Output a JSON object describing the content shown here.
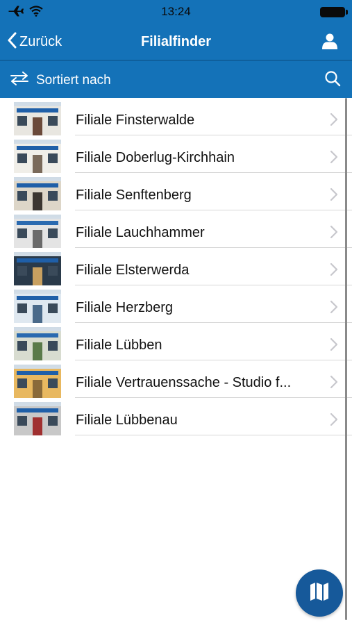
{
  "status_bar": {
    "time": "13:24"
  },
  "nav": {
    "back_label": "Zurück",
    "title": "Filialfinder"
  },
  "sort": {
    "label": "Sortiert nach"
  },
  "branches": [
    {
      "label": "Filiale Finsterwalde",
      "thumb": {
        "wall": "#e8e6e0",
        "sign": "#1f5fa8",
        "door": "#6b4a3a"
      }
    },
    {
      "label": "Filiale Doberlug-Kirchhain",
      "thumb": {
        "wall": "#f0eee8",
        "sign": "#1f5fa8",
        "door": "#7a6a5a"
      }
    },
    {
      "label": "Filiale Senftenberg",
      "thumb": {
        "wall": "#ddd6c8",
        "sign": "#1f5fa8",
        "door": "#3c3630"
      }
    },
    {
      "label": "Filiale Lauchhammer",
      "thumb": {
        "wall": "#e4e4e4",
        "sign": "#2a6ab0",
        "door": "#6a6a6a"
      }
    },
    {
      "label": "Filiale Elsterwerda",
      "thumb": {
        "wall": "#2a3a4a",
        "sign": "#1f5fa8",
        "door": "#c8a060"
      }
    },
    {
      "label": "Filiale Herzberg",
      "thumb": {
        "wall": "#dfe8f0",
        "sign": "#1f5fa8",
        "door": "#4a6a8a"
      }
    },
    {
      "label": "Filiale Lübben",
      "thumb": {
        "wall": "#d8dcd0",
        "sign": "#2a6ab0",
        "door": "#5a7a4a"
      }
    },
    {
      "label": "Filiale Vertrauenssache - Studio f...",
      "thumb": {
        "wall": "#e8b860",
        "sign": "#1f5fa8",
        "door": "#8a6a3a"
      }
    },
    {
      "label": "Filiale Lübbenau",
      "thumb": {
        "wall": "#c8c8c8",
        "sign": "#1f5fa8",
        "door": "#a03030"
      }
    }
  ],
  "colors": {
    "header": "#1472b8",
    "fab": "#16599a",
    "chevron": "#c7c7cc"
  },
  "icons": {
    "back": "chevron-left-icon",
    "profile": "person-icon",
    "sort": "swap-arrows-icon",
    "search": "search-icon",
    "map": "map-icon"
  }
}
